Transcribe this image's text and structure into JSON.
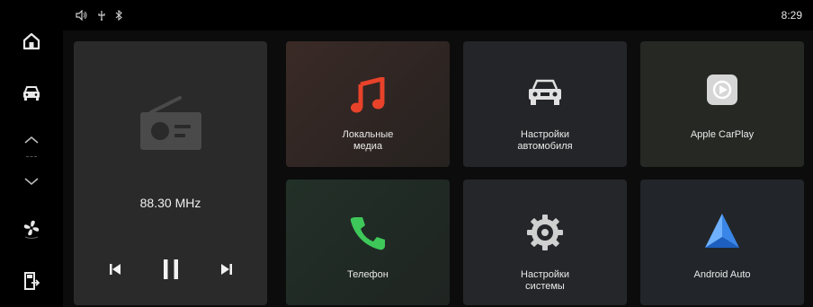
{
  "status": {
    "time": "8:29",
    "icons": [
      "volume-icon",
      "usb-icon",
      "bluetooth-icon"
    ]
  },
  "sidebar": {
    "items": [
      "home-icon",
      "car-icon",
      "chevron-up-icon",
      "chevron-down-icon",
      "fan-icon",
      "exit-icon"
    ]
  },
  "radio": {
    "frequency": "88.30 MHz",
    "controls": [
      "previous-track-icon",
      "pause-icon",
      "next-track-icon"
    ]
  },
  "tiles": [
    {
      "label": "Локальные\nмедиа",
      "icon": "music-note-icon",
      "accent": "#e8422b"
    },
    {
      "label": "Настройки\nавтомобиля",
      "icon": "car-settings-icon",
      "accent": "#e0e0e0"
    },
    {
      "label": "Apple CarPlay",
      "icon": "carplay-icon",
      "accent": "#d6d6d6"
    },
    {
      "label": "Телефон",
      "icon": "phone-icon",
      "accent": "#3ec85a"
    },
    {
      "label": "Настройки\nсистемы",
      "icon": "gear-icon",
      "accent": "#d0d0d0"
    },
    {
      "label": "Android Auto",
      "icon": "android-auto-icon",
      "accent": "#3a86e8"
    }
  ]
}
